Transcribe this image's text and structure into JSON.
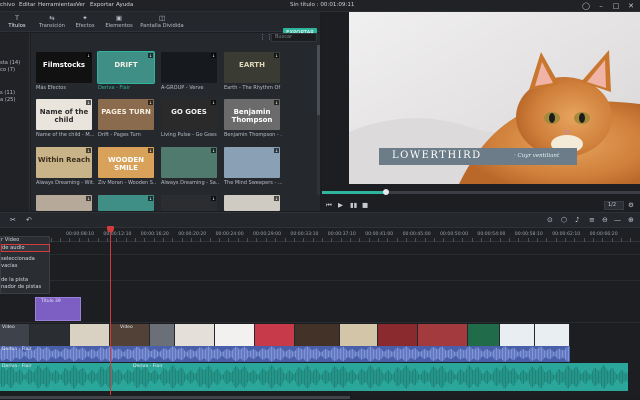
{
  "menu": {
    "items": [
      "chivo",
      "Editar",
      "Herramientas",
      "Ver",
      "Exportar",
      "Ayuda"
    ],
    "title": "Sin título : 00:01:09:11"
  },
  "tabs": [
    {
      "label": "Títulos",
      "icon": "T"
    },
    {
      "label": "Transición",
      "icon": "⇆"
    },
    {
      "label": "Efectos",
      "icon": "✦"
    },
    {
      "label": "Elementos",
      "icon": "▣"
    },
    {
      "label": "Pantalla Dividida",
      "icon": "◫"
    }
  ],
  "export_label": "EXPORTAR",
  "categories": [
    "sta (14)",
    "co (7)",
    "",
    "s (11)",
    "a (25)"
  ],
  "search_placeholder": "Buscar",
  "library": [
    {
      "label": "Más Efectos",
      "thumb_text": "Filmstocks",
      "bg": "#111111",
      "fg": "#ffffff"
    },
    {
      "label": "Deriva - Flair",
      "thumb_text": "DRIFT",
      "bg": "#3f8f86",
      "fg": "#f2f0e6",
      "selected": true
    },
    {
      "label": "A-GROUP - Verve",
      "thumb_text": "",
      "bg": "#16191d",
      "fg": "#ffffff"
    },
    {
      "label": "Earth - The Rhythm Of ...",
      "thumb_text": "EARTH",
      "bg": "#3a3c33",
      "fg": "#ded6b8"
    },
    {
      "label": "Name of the child - M...",
      "thumb_text": "Name of the child",
      "bg": "#e9e4dc",
      "fg": "#2b2b2b"
    },
    {
      "label": "Drift - Pages Turn",
      "thumb_text": "PAGES TURN",
      "bg": "#8b6b4e",
      "fg": "#f7efe0"
    },
    {
      "label": "Living Pulse - Go Goes",
      "thumb_text": "GO GOES",
      "bg": "#2a2a2a",
      "fg": "#f1f1f1"
    },
    {
      "label": "Benjamin Thompson - ...",
      "thumb_text": "Benjamin Thompson",
      "bg": "#6b6b6b",
      "fg": "#ffffff"
    },
    {
      "label": "Always Dreaming - Wit...",
      "thumb_text": "Within Reach",
      "bg": "#c9b48a",
      "fg": "#3c2f1e"
    },
    {
      "label": "Ziv Moran - Wooden S...",
      "thumb_text": "WOODEN SMILE",
      "bg": "#d9a25a",
      "fg": "#ffffff"
    },
    {
      "label": "Always Dreaming - Sa...",
      "thumb_text": "",
      "bg": "#4f7a6d",
      "fg": "#ffffff"
    },
    {
      "label": "The Mind Sweepers - ...",
      "thumb_text": "",
      "bg": "#8aa0b4",
      "fg": "#ffffff"
    },
    {
      "label": "",
      "thumb_text": "",
      "bg": "#b7a99a",
      "fg": "#ffffff"
    },
    {
      "label": "",
      "thumb_text": "",
      "bg": "#3f8f86",
      "fg": "#ffffff"
    },
    {
      "label": "",
      "thumb_text": "",
      "bg": "#2b2d31",
      "fg": "#ffffff"
    },
    {
      "label": "",
      "thumb_text": "",
      "bg": "#cfcac2",
      "fg": "#ffffff"
    }
  ],
  "preview": {
    "lowerthird_title": "LOWERTHIRD",
    "lowerthird_sub": "· Cuyr ventiliant",
    "progress": 0.2,
    "ratio": "1/2"
  },
  "ruler_labels": [
    "00:00:08:10",
    "00:00:12:10",
    "00:00:16:20",
    "00:00:20:20",
    "00:00:24:00",
    "00:00:29:00",
    "00:00:33:10",
    "00:00:37:10",
    "00:00:41:00",
    "00:00:45:00",
    "00:00:50:00",
    "00:00:54:00",
    "00:00:58:10",
    "00:00:62:10",
    "00:00:66:20"
  ],
  "context_menu": [
    "r Video",
    "de audio",
    "",
    "seleccionada",
    "vacías",
    "",
    "de la pista",
    "nador de pistas"
  ],
  "timeline": {
    "title_clip": "Título 39",
    "video_label_1": "Vídeo",
    "video_label_2": "Vídeo",
    "audio_label_1": "Deriva - Flair",
    "audio_label_2": "Deriva - Flair"
  },
  "colors": {
    "accent": "#2fb59d",
    "playhead": "#d33b3b",
    "audio_a": "#4a5fa9",
    "audio_b": "#2aa69a",
    "title_clip": "#7d5fc4"
  }
}
